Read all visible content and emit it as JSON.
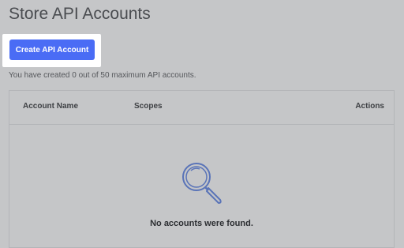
{
  "page": {
    "title": "Store API Accounts"
  },
  "toolbar": {
    "create_label": "Create API Account"
  },
  "limit_note": "You have created 0 out of 50 maximum API accounts.",
  "table": {
    "columns": [
      "Account Name",
      "Scopes",
      "Actions"
    ],
    "rows": [],
    "empty_message": "No accounts were found."
  },
  "colors": {
    "accent": "#4a6cf5",
    "overlay_background": "#c5c6c8",
    "icon_stroke": "#5a74b8"
  },
  "icons": {
    "empty_state": "magnifier-icon"
  }
}
